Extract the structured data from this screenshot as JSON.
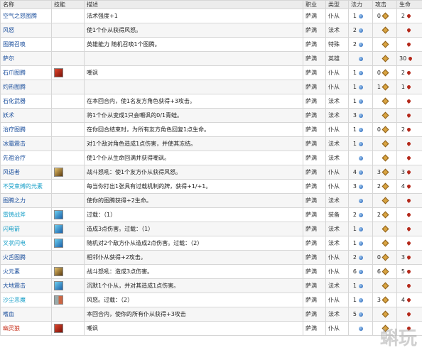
{
  "columns": [
    "名称",
    "技能",
    "描述",
    "职业",
    "类型",
    "法力",
    "攻击",
    "生命"
  ],
  "rows": [
    {
      "name": "空气之怒图腾",
      "name_color": "blue",
      "skill": "",
      "desc": "法术强度+1",
      "cls": "萨满",
      "type": "仆从",
      "mana": "1",
      "atk": "0",
      "hp": "2"
    },
    {
      "name": "风怒",
      "name_color": "blue",
      "skill": "",
      "desc": "使1个仆从获得风怒。",
      "cls": "萨满",
      "type": "法术",
      "mana": "2",
      "atk": "",
      "hp": ""
    },
    {
      "name": "图腾召唤",
      "name_color": "blue",
      "skill": "",
      "desc": "英雄能力 随机召唤1个图腾。",
      "cls": "萨满",
      "type": "特殊",
      "mana": "2",
      "atk": "",
      "hp": ""
    },
    {
      "name": "萨尔",
      "name_color": "blue",
      "skill": "",
      "desc": "",
      "cls": "萨满",
      "type": "英雄",
      "mana": "",
      "atk": "",
      "hp": "30"
    },
    {
      "name": "石爪图腾",
      "name_color": "blue",
      "skill": "red",
      "desc": "嘲讽",
      "cls": "萨满",
      "type": "仆从",
      "mana": "1",
      "atk": "0",
      "hp": "2"
    },
    {
      "name": "灼热图腾",
      "name_color": "blue",
      "skill": "",
      "desc": "",
      "cls": "萨满",
      "type": "仆从",
      "mana": "1",
      "atk": "1",
      "hp": "1"
    },
    {
      "name": "石化武器",
      "name_color": "blue",
      "skill": "",
      "desc": "在本回合内，使1名友方角色获得+3攻击。",
      "cls": "萨满",
      "type": "法术",
      "mana": "1",
      "atk": "",
      "hp": ""
    },
    {
      "name": "妖术",
      "name_color": "blue",
      "skill": "",
      "desc": "将1个仆从变成1只会嘲讽的0/1青蛙。",
      "cls": "萨满",
      "type": "法术",
      "mana": "3",
      "atk": "",
      "hp": ""
    },
    {
      "name": "治疗图腾",
      "name_color": "blue",
      "skill": "",
      "desc": "在你回合结束时，为所有友方角色回复1点生命。",
      "cls": "萨满",
      "type": "仆从",
      "mana": "1",
      "atk": "0",
      "hp": "2"
    },
    {
      "name": "冰霜震击",
      "name_color": "blue",
      "skill": "",
      "desc": "对1个敌对角色造成1点伤害，并使其冻结。",
      "cls": "萨满",
      "type": "法术",
      "mana": "1",
      "atk": "",
      "hp": ""
    },
    {
      "name": "先祖治疗",
      "name_color": "blue",
      "skill": "",
      "desc": "使1个仆从生命回满并获得嘲讽。",
      "cls": "萨满",
      "type": "法术",
      "mana": "",
      "atk": "",
      "hp": ""
    },
    {
      "name": "风语者",
      "name_color": "blue",
      "skill": "gold",
      "desc": "战斗怒吼：使1个友方仆从获得风怒。",
      "cls": "萨满",
      "type": "仆从",
      "mana": "4",
      "atk": "3",
      "hp": "3"
    },
    {
      "name": "不受束缚的元素",
      "name_color": "cyan",
      "skill": "",
      "desc": "每当你打出1张具有过载机制的牌，获得+1/+1。",
      "cls": "萨满",
      "type": "仆从",
      "mana": "3",
      "atk": "2",
      "hp": "4"
    },
    {
      "name": "图腾之力",
      "name_color": "blue",
      "skill": "",
      "desc": "使你的图腾获得+2生命。",
      "cls": "萨满",
      "type": "法术",
      "mana": "",
      "atk": "",
      "hp": ""
    },
    {
      "name": "雷铸战斧",
      "name_color": "cyan",
      "skill": "blue",
      "desc": "过载：（1）",
      "cls": "萨满",
      "type": "装备",
      "mana": "2",
      "atk": "2",
      "hp": ""
    },
    {
      "name": "闪电箭",
      "name_color": "cyan",
      "skill": "blue",
      "desc": "造成3点伤害。过载：（1）",
      "cls": "萨满",
      "type": "法术",
      "mana": "1",
      "atk": "",
      "hp": ""
    },
    {
      "name": "叉状闪电",
      "name_color": "cyan",
      "skill": "blue",
      "desc": "随机对2个敌方仆从造成2点伤害。过载：（2）",
      "cls": "萨满",
      "type": "法术",
      "mana": "1",
      "atk": "",
      "hp": ""
    },
    {
      "name": "火舌图腾",
      "name_color": "blue",
      "skill": "",
      "desc": "相邻仆从获得+2攻击。",
      "cls": "萨满",
      "type": "仆从",
      "mana": "2",
      "atk": "0",
      "hp": "3"
    },
    {
      "name": "火元素",
      "name_color": "blue",
      "skill": "gold",
      "desc": "战斗怒吼：造成3点伤害。",
      "cls": "萨满",
      "type": "仆从",
      "mana": "6",
      "atk": "6",
      "hp": "5"
    },
    {
      "name": "大地震击",
      "name_color": "blue",
      "skill": "blue",
      "desc": "沉默1个仆从，并对其造成1点伤害。",
      "cls": "萨满",
      "type": "法术",
      "mana": "1",
      "atk": "",
      "hp": ""
    },
    {
      "name": "沙尘恶魔",
      "name_color": "cyan",
      "skill": "mixed",
      "desc": "风怒。过载：（2）",
      "cls": "萨满",
      "type": "仆从",
      "mana": "1",
      "atk": "3",
      "hp": "4"
    },
    {
      "name": "嗜血",
      "name_color": "blue",
      "skill": "",
      "desc": "本回合内，使你的所有仆从获得+3攻击",
      "cls": "萨满",
      "type": "法术",
      "mana": "5",
      "atk": "",
      "hp": ""
    },
    {
      "name": "幽灵狼",
      "name_color": "red",
      "skill": "red",
      "desc": "嘲讽",
      "cls": "萨满",
      "type": "仆从",
      "mana": "",
      "atk": "",
      "hp": ""
    }
  ],
  "icons": {
    "mana": "mana-crystal-icon",
    "atk": "attack-icon",
    "hp": "health-drop-icon"
  },
  "watermark": "蝌玩",
  "colors": {
    "name_blue": "#1a4e9c",
    "name_cyan": "#1aa0c8",
    "name_red": "#c8321e"
  }
}
